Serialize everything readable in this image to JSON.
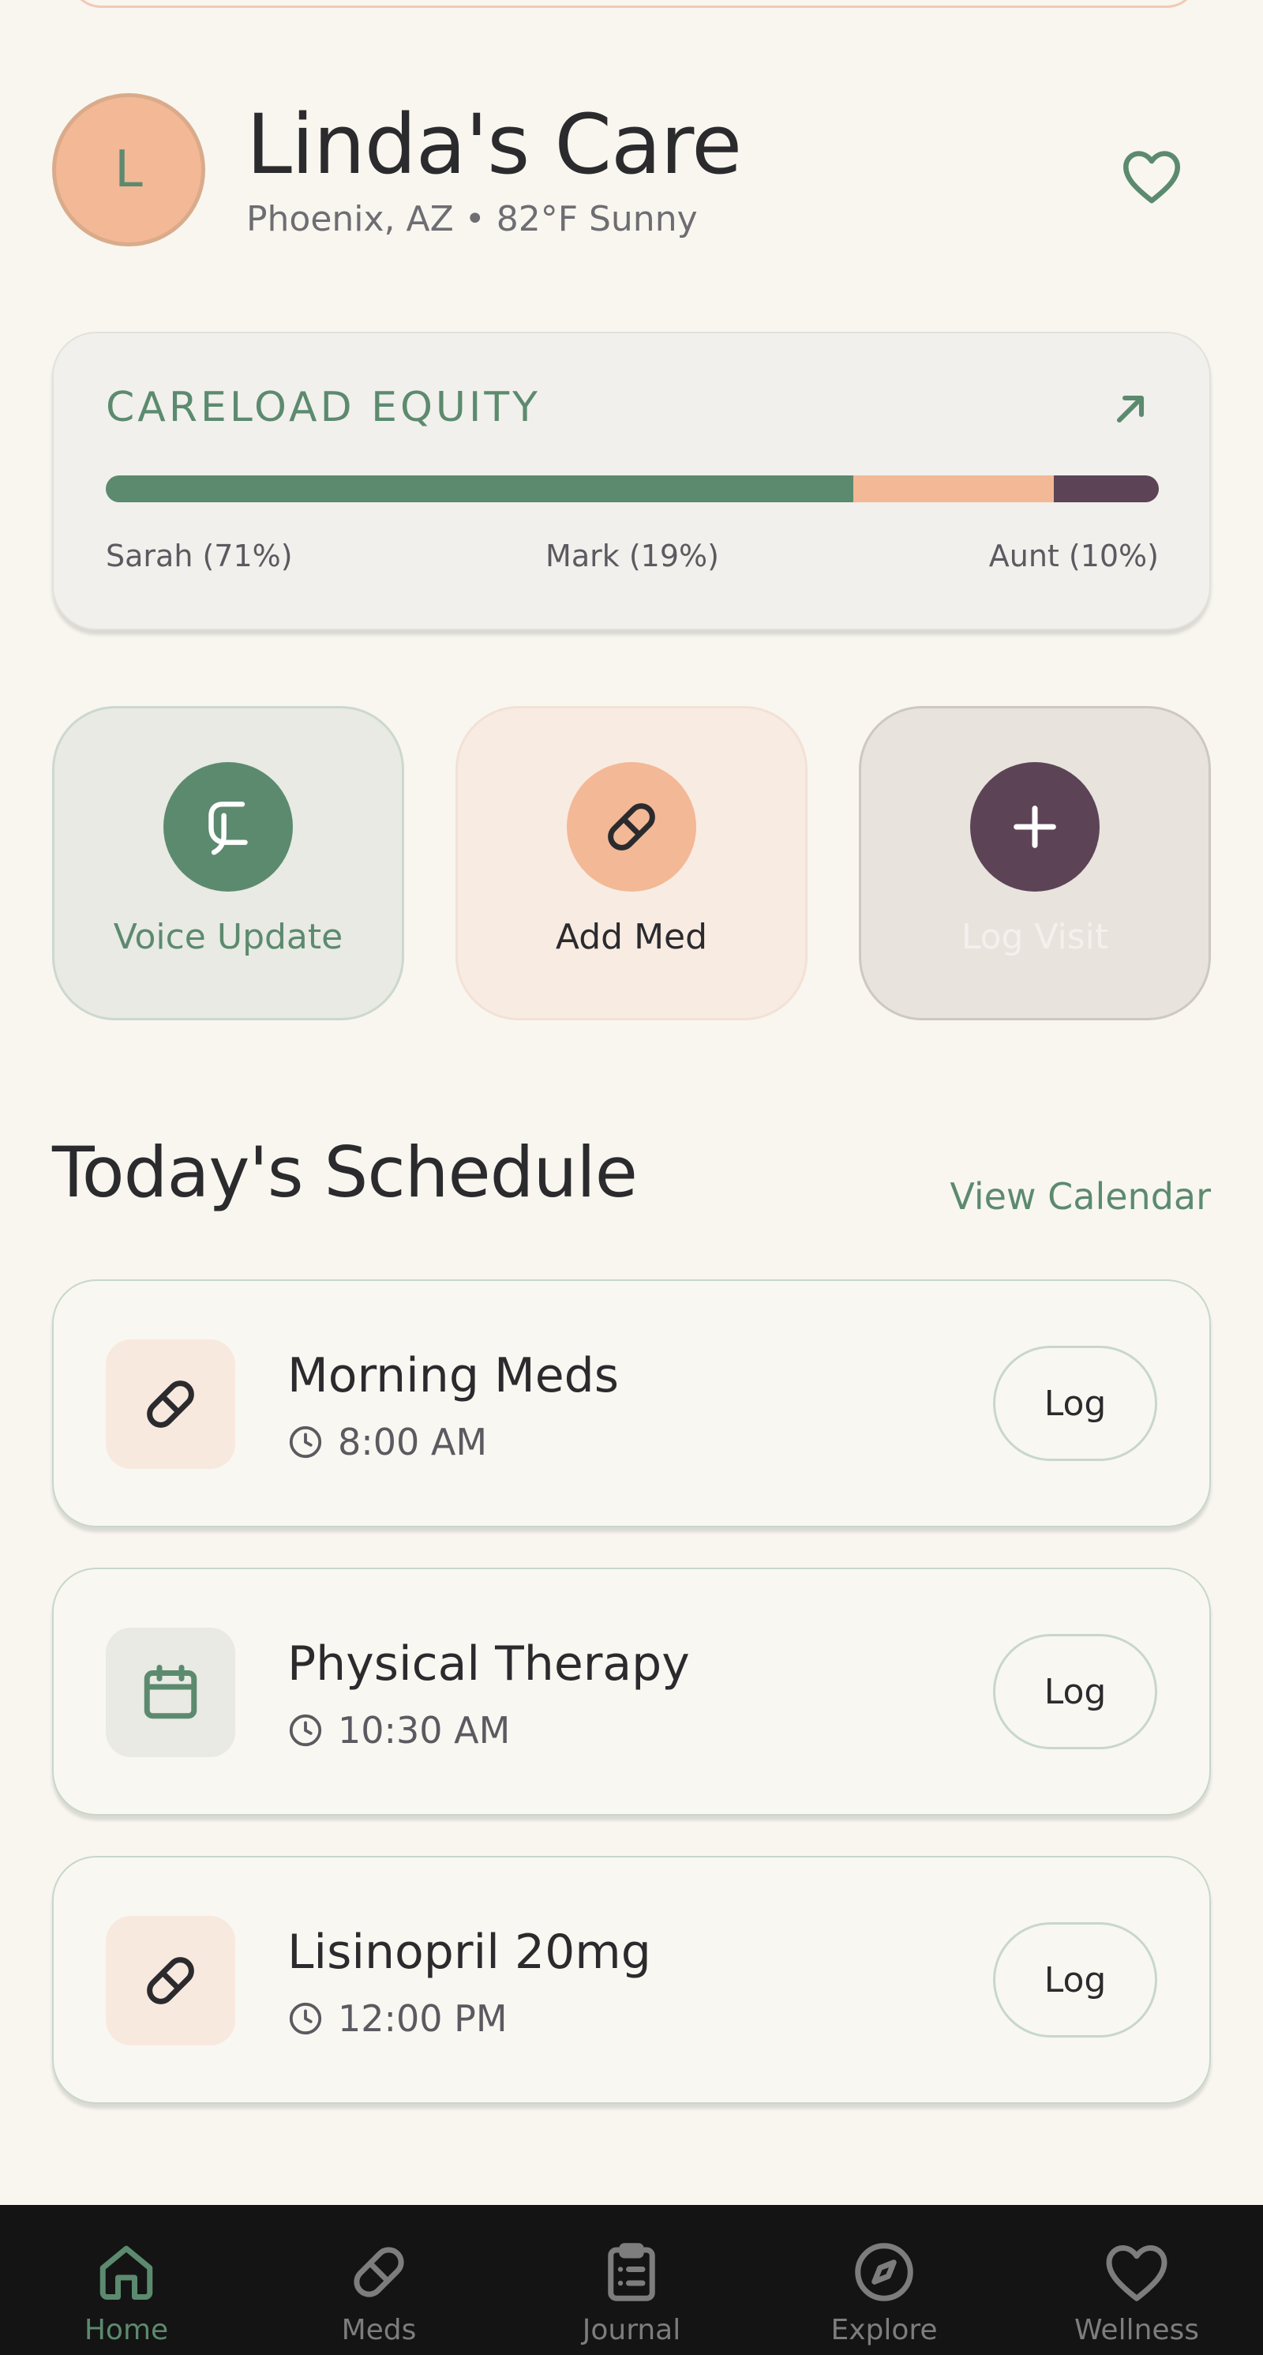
{
  "header": {
    "avatar_initial": "L",
    "title": "Linda's Care",
    "subtitle": "Phoenix, AZ • 82°F Sunny",
    "favorite_icon": "heart-icon"
  },
  "equity": {
    "label": "CARELOAD EQUITY",
    "expand_icon": "arrow-up-right-icon",
    "segments": [
      {
        "name": "Sarah",
        "percent": 71,
        "color": "#5c8a6f",
        "label": "Sarah (71%)"
      },
      {
        "name": "Mark",
        "percent": 19,
        "color": "#f3b896",
        "label": "Mark (19%)"
      },
      {
        "name": "Aunt",
        "percent": 10,
        "color": "#5c4356",
        "label": "Aunt (10%)"
      }
    ]
  },
  "quick_actions": [
    {
      "label": "Voice Update",
      "icon": "voice-icon"
    },
    {
      "label": "Add Med",
      "icon": "pill-icon"
    },
    {
      "label": "Log Visit",
      "icon": "plus-icon"
    }
  ],
  "schedule": {
    "title": "Today's Schedule",
    "link": "View Calendar",
    "items": [
      {
        "name": "Morning Meds",
        "time": "8:00 AM",
        "icon": "pill-icon",
        "action": "Log"
      },
      {
        "name": "Physical Therapy",
        "time": "10:30 AM",
        "icon": "calendar-icon",
        "action": "Log"
      },
      {
        "name": "Lisinopril 20mg",
        "time": "12:00 PM",
        "icon": "pill-icon",
        "action": "Log"
      }
    ]
  },
  "nav": {
    "items": [
      {
        "label": "Home",
        "icon": "home-icon",
        "active": true
      },
      {
        "label": "Meds",
        "icon": "pill-icon",
        "active": false
      },
      {
        "label": "Journal",
        "icon": "clipboard-icon",
        "active": false
      },
      {
        "label": "Explore",
        "icon": "compass-icon",
        "active": false
      },
      {
        "label": "Wellness",
        "icon": "heart-icon",
        "active": false
      }
    ]
  },
  "colors": {
    "background": "#f8f6ef",
    "sage": "#5c8a6f",
    "peach": "#f3b896",
    "plum": "#5c4356",
    "nav_background": "#141414"
  }
}
